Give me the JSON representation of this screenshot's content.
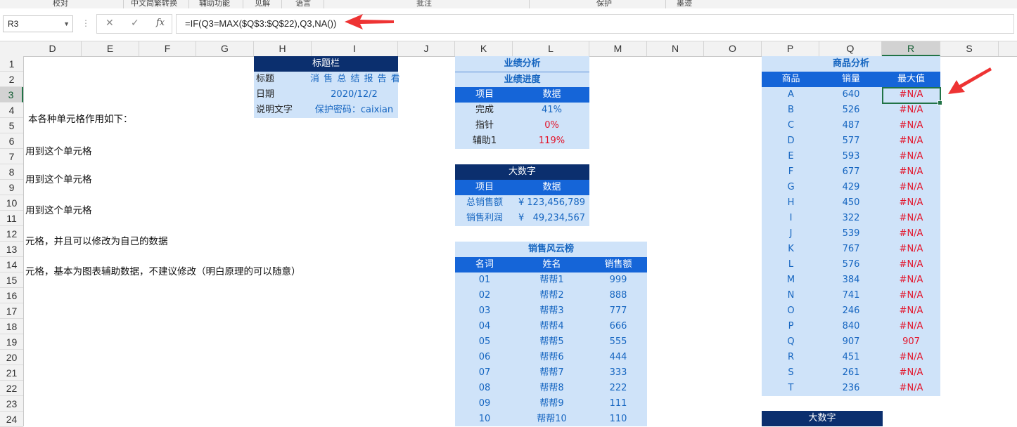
{
  "ribbon": [
    "校对",
    "中文简繁转换",
    "辅助功能",
    "见解",
    "语言",
    "批注",
    "保护",
    "墨迹"
  ],
  "formula_bar": {
    "name_box": "R3",
    "cancel_icon": "✕",
    "enter_icon": "✓",
    "fx_icon": "fx",
    "formula": "=IF(Q3=MAX($Q$3:$Q$22),Q3,NA())"
  },
  "columns": [
    "D",
    "E",
    "F",
    "G",
    "H",
    "I",
    "J",
    "K",
    "L",
    "M",
    "N",
    "O",
    "P",
    "Q",
    "R",
    "S"
  ],
  "rows": [
    "1",
    "2",
    "3",
    "4",
    "5",
    "6",
    "7",
    "8",
    "9",
    "10",
    "11",
    "12",
    "13",
    "14",
    "15",
    "16",
    "17",
    "18",
    "19",
    "20",
    "21",
    "22",
    "23",
    "24"
  ],
  "left_text": {
    "line1": "本各种单元格作用如下：",
    "line2": "用到这个单元格",
    "line3": "用到这个单元格",
    "line4": "用到这个单元格",
    "line5": "元格，并且可以修改为自己的数据",
    "line6": "元格，基本为图表辅助数据，不建议修改（明白原理的可以随意）"
  },
  "title_block": {
    "header": "标题栏",
    "rows": [
      {
        "label": "标题",
        "value": "消 售 总 结 报 告 看 板"
      },
      {
        "label": "日期",
        "value": "2020/12/2"
      },
      {
        "label": "说明文字",
        "value": "保护密码：caixian"
      }
    ]
  },
  "perf": {
    "title": "业绩分析",
    "subtitle": "业绩进度",
    "col1": "项目",
    "col2": "数据",
    "rows": [
      {
        "label": "完成",
        "value": "41%",
        "red": false
      },
      {
        "label": "指针",
        "value": "0%",
        "red": true
      },
      {
        "label": "辅助1",
        "value": "119%",
        "red": true
      }
    ]
  },
  "big_number": {
    "title": "大数字",
    "col1": "项目",
    "col2": "数据",
    "rows": [
      {
        "label": "总销售额",
        "currency": "¥",
        "value": "123,456,789"
      },
      {
        "label": "销售利润",
        "currency": "¥",
        "value": "49,234,567"
      }
    ]
  },
  "ranking": {
    "title": "销售风云榜",
    "headers": [
      "名词",
      "姓名",
      "销售额"
    ],
    "rows": [
      [
        "01",
        "帮帮1",
        "999"
      ],
      [
        "02",
        "帮帮2",
        "888"
      ],
      [
        "03",
        "帮帮3",
        "777"
      ],
      [
        "04",
        "帮帮4",
        "666"
      ],
      [
        "05",
        "帮帮5",
        "555"
      ],
      [
        "06",
        "帮帮6",
        "444"
      ],
      [
        "07",
        "帮帮7",
        "333"
      ],
      [
        "08",
        "帮帮8",
        "222"
      ],
      [
        "09",
        "帮帮9",
        "111"
      ],
      [
        "10",
        "帮帮10",
        "110"
      ]
    ]
  },
  "products": {
    "title": "商品分析",
    "headers": [
      "商品",
      "销量",
      "最大值"
    ],
    "rows": [
      [
        "A",
        "640",
        "#N/A"
      ],
      [
        "B",
        "526",
        "#N/A"
      ],
      [
        "C",
        "487",
        "#N/A"
      ],
      [
        "D",
        "577",
        "#N/A"
      ],
      [
        "E",
        "593",
        "#N/A"
      ],
      [
        "F",
        "677",
        "#N/A"
      ],
      [
        "G",
        "429",
        "#N/A"
      ],
      [
        "H",
        "450",
        "#N/A"
      ],
      [
        "I",
        "322",
        "#N/A"
      ],
      [
        "J",
        "539",
        "#N/A"
      ],
      [
        "K",
        "767",
        "#N/A"
      ],
      [
        "L",
        "576",
        "#N/A"
      ],
      [
        "M",
        "384",
        "#N/A"
      ],
      [
        "N",
        "741",
        "#N/A"
      ],
      [
        "O",
        "246",
        "#N/A"
      ],
      [
        "P",
        "840",
        "#N/A"
      ],
      [
        "Q",
        "907",
        "907"
      ],
      [
        "R",
        "451",
        "#N/A"
      ],
      [
        "S",
        "261",
        "#N/A"
      ],
      [
        "T",
        "236",
        "#N/A"
      ]
    ]
  },
  "big_number2": {
    "title": "大数字"
  }
}
